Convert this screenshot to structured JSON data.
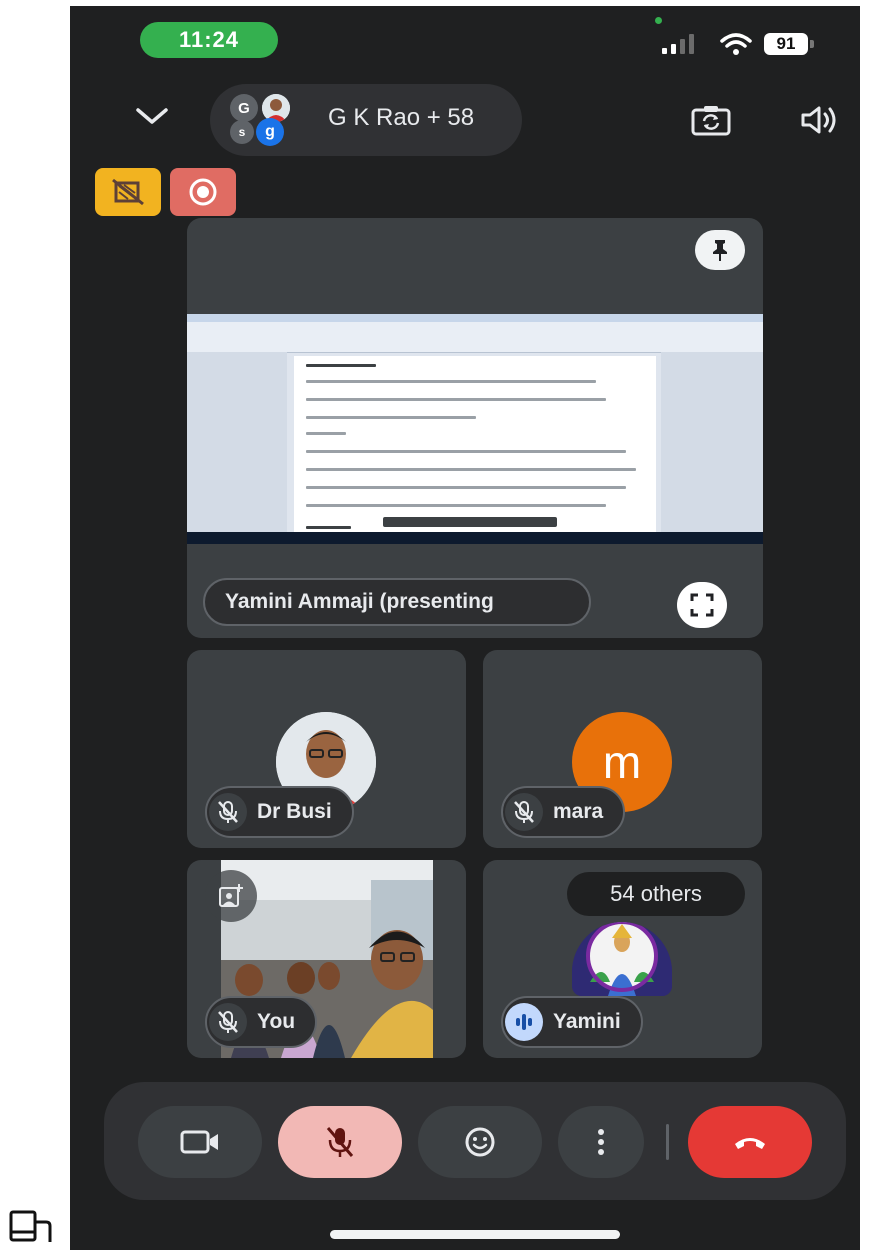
{
  "status": {
    "time": "11:24",
    "battery": "91"
  },
  "header": {
    "call_title": "G K Rao + 58",
    "avatar_letters": [
      "G",
      "s",
      "g"
    ]
  },
  "presenter": {
    "name": "Yamini Ammaji (presenting"
  },
  "participants": [
    {
      "name": "Dr Busi"
    },
    {
      "name": "mara",
      "initial": "m"
    },
    {
      "name": "You"
    },
    {
      "name": "Yamini",
      "others_label": "54 others"
    }
  ],
  "colors": {
    "background": "#1f2021",
    "tile": "#3c4043",
    "end_call": "#e53935",
    "mute_active": "#f2b8b5",
    "mara_avatar": "#e8710a",
    "time_pill": "#34b04f"
  },
  "icons": [
    "chevron-down-icon",
    "camera-switch-icon",
    "speaker-icon",
    "no-video-icon",
    "record-icon",
    "pin-icon",
    "fullscreen-icon",
    "mic-off-icon",
    "add-photo-icon",
    "audio-active-icon",
    "video-camera-icon",
    "emoji-icon",
    "more-vert-icon",
    "end-call-icon",
    "tablet-icon"
  ]
}
